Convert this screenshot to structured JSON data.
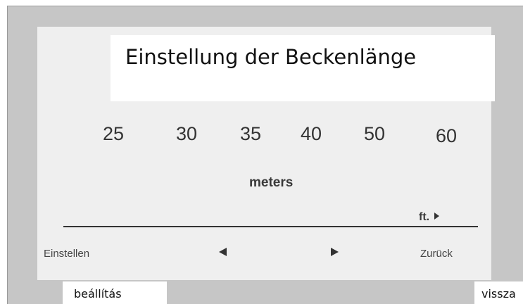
{
  "title": "Einstellung der Beckenlänge",
  "lengths": [
    "25",
    "30",
    "35",
    "40",
    "50",
    "60"
  ],
  "unit_meters": "meters",
  "unit_ft": "ft.",
  "softkeys": {
    "set": "Einstellen",
    "back": "Zurück"
  },
  "annotations": {
    "set_hu": "beállítás",
    "back_hu": "vissza"
  },
  "colors": {
    "frame": "#c6c6c6",
    "screen": "#efefef",
    "text": "#333333"
  },
  "icons": {
    "left": "triangle-left",
    "right": "triangle-right",
    "ft": "triangle-right-small"
  }
}
